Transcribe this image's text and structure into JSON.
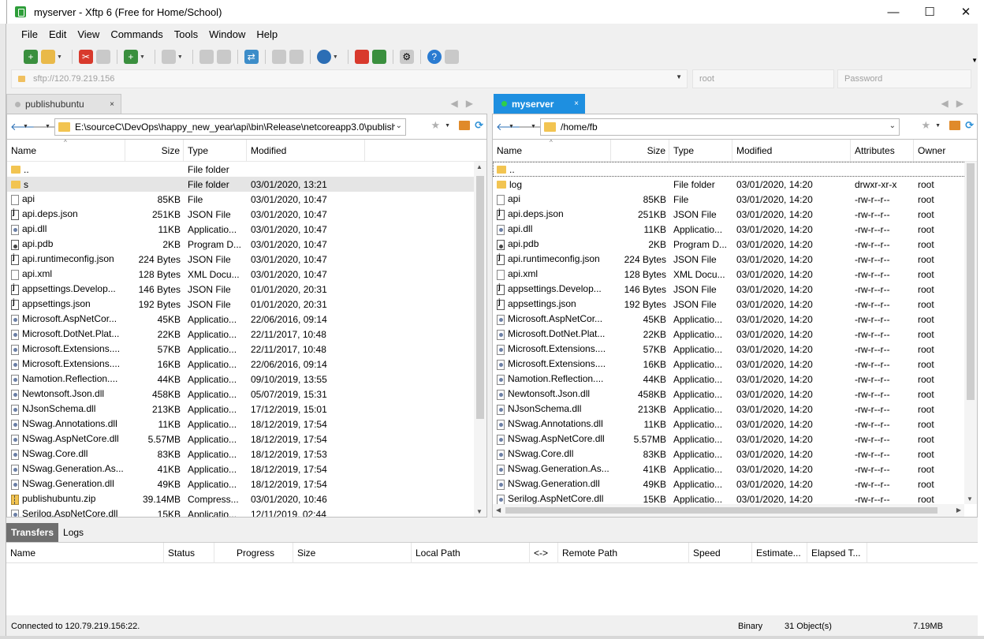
{
  "window": {
    "title": "myserver - Xftp 6 (Free for Home/School)",
    "minimize": "—",
    "maximize": "☐",
    "close": "✕"
  },
  "menu": [
    "File",
    "Edit",
    "View",
    "Commands",
    "Tools",
    "Window",
    "Help"
  ],
  "address": {
    "host": "sftp://120.79.219.156",
    "user_placeholder": "root",
    "password_placeholder": "Password"
  },
  "left_pane": {
    "tab_label": "publishubuntu",
    "tab_close": "×",
    "path": "E:\\sourceC\\DevOps\\happy_new_year\\api\\bin\\Release\\netcoreapp3.0\\publish",
    "columns": [
      "Name",
      "Size",
      "Type",
      "Modified"
    ],
    "rows": [
      {
        "icon": "folder",
        "name": "..",
        "size": "",
        "type": "File folder",
        "modified": ""
      },
      {
        "icon": "folder",
        "name": "s",
        "size": "",
        "type": "File folder",
        "modified": "03/01/2020, 13:21",
        "selected": true
      },
      {
        "icon": "file",
        "name": "api",
        "size": "85KB",
        "type": "File",
        "modified": "03/01/2020, 10:47"
      },
      {
        "icon": "json",
        "name": "api.deps.json",
        "size": "251KB",
        "type": "JSON File",
        "modified": "03/01/2020, 10:47"
      },
      {
        "icon": "dll",
        "name": "api.dll",
        "size": "11KB",
        "type": "Applicatio...",
        "modified": "03/01/2020, 10:47"
      },
      {
        "icon": "pdb",
        "name": "api.pdb",
        "size": "2KB",
        "type": "Program D...",
        "modified": "03/01/2020, 10:47"
      },
      {
        "icon": "json",
        "name": "api.runtimeconfig.json",
        "size": "224 Bytes",
        "type": "JSON File",
        "modified": "03/01/2020, 10:47"
      },
      {
        "icon": "file",
        "name": "api.xml",
        "size": "128 Bytes",
        "type": "XML Docu...",
        "modified": "03/01/2020, 10:47"
      },
      {
        "icon": "json",
        "name": "appsettings.Develop...",
        "size": "146 Bytes",
        "type": "JSON File",
        "modified": "01/01/2020, 20:31"
      },
      {
        "icon": "json",
        "name": "appsettings.json",
        "size": "192 Bytes",
        "type": "JSON File",
        "modified": "01/01/2020, 20:31"
      },
      {
        "icon": "dll",
        "name": "Microsoft.AspNetCor...",
        "size": "45KB",
        "type": "Applicatio...",
        "modified": "22/06/2016, 09:14"
      },
      {
        "icon": "dll",
        "name": "Microsoft.DotNet.Plat...",
        "size": "22KB",
        "type": "Applicatio...",
        "modified": "22/11/2017, 10:48"
      },
      {
        "icon": "dll",
        "name": "Microsoft.Extensions....",
        "size": "57KB",
        "type": "Applicatio...",
        "modified": "22/11/2017, 10:48"
      },
      {
        "icon": "dll",
        "name": "Microsoft.Extensions....",
        "size": "16KB",
        "type": "Applicatio...",
        "modified": "22/06/2016, 09:14"
      },
      {
        "icon": "dll",
        "name": "Namotion.Reflection....",
        "size": "44KB",
        "type": "Applicatio...",
        "modified": "09/10/2019, 13:55"
      },
      {
        "icon": "dll",
        "name": "Newtonsoft.Json.dll",
        "size": "458KB",
        "type": "Applicatio...",
        "modified": "05/07/2019, 15:31"
      },
      {
        "icon": "dll",
        "name": "NJsonSchema.dll",
        "size": "213KB",
        "type": "Applicatio...",
        "modified": "17/12/2019, 15:01"
      },
      {
        "icon": "dll",
        "name": "NSwag.Annotations.dll",
        "size": "11KB",
        "type": "Applicatio...",
        "modified": "18/12/2019, 17:54"
      },
      {
        "icon": "dll",
        "name": "NSwag.AspNetCore.dll",
        "size": "5.57MB",
        "type": "Applicatio...",
        "modified": "18/12/2019, 17:54"
      },
      {
        "icon": "dll",
        "name": "NSwag.Core.dll",
        "size": "83KB",
        "type": "Applicatio...",
        "modified": "18/12/2019, 17:53"
      },
      {
        "icon": "dll",
        "name": "NSwag.Generation.As...",
        "size": "41KB",
        "type": "Applicatio...",
        "modified": "18/12/2019, 17:54"
      },
      {
        "icon": "dll",
        "name": "NSwag.Generation.dll",
        "size": "49KB",
        "type": "Applicatio...",
        "modified": "18/12/2019, 17:54"
      },
      {
        "icon": "zip",
        "name": "publishubuntu.zip",
        "size": "39.14MB",
        "type": "Compress...",
        "modified": "03/01/2020, 10:46"
      },
      {
        "icon": "dll",
        "name": "Serilog.AspNetCore.dll",
        "size": "15KB",
        "type": "Applicatio...",
        "modified": "12/11/2019, 02:44"
      }
    ]
  },
  "right_pane": {
    "tab_label": "myserver",
    "tab_close": "×",
    "path": "/home/fb",
    "columns": [
      "Name",
      "Size",
      "Type",
      "Modified",
      "Attributes",
      "Owner"
    ],
    "rows": [
      {
        "icon": "folder",
        "name": "..",
        "size": "",
        "type": "",
        "modified": "",
        "attr": "",
        "owner": "",
        "dotted": true
      },
      {
        "icon": "folder",
        "name": "log",
        "size": "",
        "type": "File folder",
        "modified": "03/01/2020, 14:20",
        "attr": "drwxr-xr-x",
        "owner": "root"
      },
      {
        "icon": "file",
        "name": "api",
        "size": "85KB",
        "type": "File",
        "modified": "03/01/2020, 14:20",
        "attr": "-rw-r--r--",
        "owner": "root"
      },
      {
        "icon": "json",
        "name": "api.deps.json",
        "size": "251KB",
        "type": "JSON File",
        "modified": "03/01/2020, 14:20",
        "attr": "-rw-r--r--",
        "owner": "root"
      },
      {
        "icon": "dll",
        "name": "api.dll",
        "size": "11KB",
        "type": "Applicatio...",
        "modified": "03/01/2020, 14:20",
        "attr": "-rw-r--r--",
        "owner": "root"
      },
      {
        "icon": "pdb",
        "name": "api.pdb",
        "size": "2KB",
        "type": "Program D...",
        "modified": "03/01/2020, 14:20",
        "attr": "-rw-r--r--",
        "owner": "root"
      },
      {
        "icon": "json",
        "name": "api.runtimeconfig.json",
        "size": "224 Bytes",
        "type": "JSON File",
        "modified": "03/01/2020, 14:20",
        "attr": "-rw-r--r--",
        "owner": "root"
      },
      {
        "icon": "file",
        "name": "api.xml",
        "size": "128 Bytes",
        "type": "XML Docu...",
        "modified": "03/01/2020, 14:20",
        "attr": "-rw-r--r--",
        "owner": "root"
      },
      {
        "icon": "json",
        "name": "appsettings.Develop...",
        "size": "146 Bytes",
        "type": "JSON File",
        "modified": "03/01/2020, 14:20",
        "attr": "-rw-r--r--",
        "owner": "root"
      },
      {
        "icon": "json",
        "name": "appsettings.json",
        "size": "192 Bytes",
        "type": "JSON File",
        "modified": "03/01/2020, 14:20",
        "attr": "-rw-r--r--",
        "owner": "root"
      },
      {
        "icon": "dll",
        "name": "Microsoft.AspNetCor...",
        "size": "45KB",
        "type": "Applicatio...",
        "modified": "03/01/2020, 14:20",
        "attr": "-rw-r--r--",
        "owner": "root"
      },
      {
        "icon": "dll",
        "name": "Microsoft.DotNet.Plat...",
        "size": "22KB",
        "type": "Applicatio...",
        "modified": "03/01/2020, 14:20",
        "attr": "-rw-r--r--",
        "owner": "root"
      },
      {
        "icon": "dll",
        "name": "Microsoft.Extensions....",
        "size": "57KB",
        "type": "Applicatio...",
        "modified": "03/01/2020, 14:20",
        "attr": "-rw-r--r--",
        "owner": "root"
      },
      {
        "icon": "dll",
        "name": "Microsoft.Extensions....",
        "size": "16KB",
        "type": "Applicatio...",
        "modified": "03/01/2020, 14:20",
        "attr": "-rw-r--r--",
        "owner": "root"
      },
      {
        "icon": "dll",
        "name": "Namotion.Reflection....",
        "size": "44KB",
        "type": "Applicatio...",
        "modified": "03/01/2020, 14:20",
        "attr": "-rw-r--r--",
        "owner": "root"
      },
      {
        "icon": "dll",
        "name": "Newtonsoft.Json.dll",
        "size": "458KB",
        "type": "Applicatio...",
        "modified": "03/01/2020, 14:20",
        "attr": "-rw-r--r--",
        "owner": "root"
      },
      {
        "icon": "dll",
        "name": "NJsonSchema.dll",
        "size": "213KB",
        "type": "Applicatio...",
        "modified": "03/01/2020, 14:20",
        "attr": "-rw-r--r--",
        "owner": "root"
      },
      {
        "icon": "dll",
        "name": "NSwag.Annotations.dll",
        "size": "11KB",
        "type": "Applicatio...",
        "modified": "03/01/2020, 14:20",
        "attr": "-rw-r--r--",
        "owner": "root"
      },
      {
        "icon": "dll",
        "name": "NSwag.AspNetCore.dll",
        "size": "5.57MB",
        "type": "Applicatio...",
        "modified": "03/01/2020, 14:20",
        "attr": "-rw-r--r--",
        "owner": "root"
      },
      {
        "icon": "dll",
        "name": "NSwag.Core.dll",
        "size": "83KB",
        "type": "Applicatio...",
        "modified": "03/01/2020, 14:20",
        "attr": "-rw-r--r--",
        "owner": "root"
      },
      {
        "icon": "dll",
        "name": "NSwag.Generation.As...",
        "size": "41KB",
        "type": "Applicatio...",
        "modified": "03/01/2020, 14:20",
        "attr": "-rw-r--r--",
        "owner": "root"
      },
      {
        "icon": "dll",
        "name": "NSwag.Generation.dll",
        "size": "49KB",
        "type": "Applicatio...",
        "modified": "03/01/2020, 14:20",
        "attr": "-rw-r--r--",
        "owner": "root"
      },
      {
        "icon": "dll",
        "name": "Serilog.AspNetCore.dll",
        "size": "15KB",
        "type": "Applicatio...",
        "modified": "03/01/2020, 14:20",
        "attr": "-rw-r--r--",
        "owner": "root"
      }
    ]
  },
  "transfers": {
    "tabs": [
      "Transfers",
      "Logs"
    ],
    "columns": [
      "Name",
      "Status",
      "Progress",
      "Size",
      "Local Path",
      "<->",
      "Remote Path",
      "Speed",
      "Estimate...",
      "Elapsed T..."
    ]
  },
  "status": {
    "connection": "Connected to 120.79.219.156:22.",
    "mode": "Binary",
    "objects": "31 Object(s)",
    "size": "7.19MB"
  },
  "colors": {
    "accent": "#1e8fe0",
    "selected_row": "#e5e5e5",
    "active_bottom_tab": "#6f6f6f"
  }
}
